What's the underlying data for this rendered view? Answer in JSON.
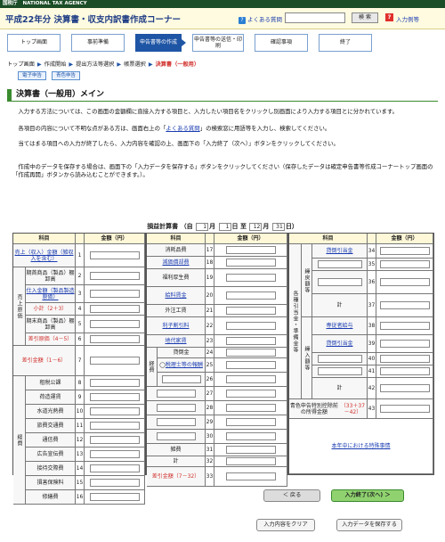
{
  "topbar": {
    "agency_ja": "国税庁",
    "agency_en": "NATIONAL TAX AGENCY"
  },
  "header": {
    "title": "平成22年分 決算書・収支内訳書作成コーナー",
    "faq_label": "よくある質問",
    "search_button": "検 索",
    "help_label": "入力例等",
    "help_icon": "?"
  },
  "steps": [
    "トップ画面",
    "事前準備",
    "申告書等の作成",
    "申告書等の送信・印刷",
    "確認事項",
    "終了"
  ],
  "breadcrumb": [
    "トップ画面",
    "作成開始",
    "提出方法等選択",
    "帳票選択",
    "決算書（一般用）"
  ],
  "tags": [
    "電子申告",
    "青色申告"
  ],
  "section_title": "決算書（一般用）メイン",
  "instructions": [
    "入力する方法については、この画面の金額欄に直接入力する項目と、入力したい項目名をクリックし別画面により入力する項目とに分かれています。",
    "各項目の内容について不明な点がある方は、画面右上の「",
    "よくある質問",
    "」の検索窓に用語等を入力し、検索してください。",
    "当てはまる項目への入力が終了したら、入力内容を確認の上、画面下の「入力終了（次へ）」ボタンをクリックしてください。",
    "作成中のデータを保存する場合は、画面下の「入力データを保存する」ボタンをクリックしてください（保存したデータは確定申告書等作成コーナートップ画面の「作成再開」ボタンから読み込むことができます。）。"
  ],
  "table_title": {
    "name": "損益計算書",
    "from_label": "自",
    "from_month": "1",
    "from_day": "1",
    "to_label": "至",
    "to_month": "12",
    "to_day": "31",
    "month": "月",
    "day": "日"
  },
  "col_headers": {
    "item": "科目",
    "amount": "金額（円）"
  },
  "left_rows": [
    {
      "label": "売上（収入）金額（雑収入を含む）",
      "num": "1",
      "link": true
    },
    {
      "label": "期首商品（製品）棚卸高",
      "num": "2"
    },
    {
      "label": "仕入金額（製品製造原価）",
      "num": "3",
      "link": true
    },
    {
      "label": "小計（2＋3）",
      "num": "4",
      "red": true
    },
    {
      "label": "期末商品（製品）棚卸高",
      "num": "5"
    },
    {
      "label": "差引原価（4－5）",
      "num": "6",
      "red": true
    },
    {
      "label": "差引金額（1－6）",
      "num": "7",
      "red": true
    },
    {
      "label": "租税公課",
      "num": "8"
    },
    {
      "label": "荷造運賃",
      "num": "9"
    },
    {
      "label": "水道光熱費",
      "num": "10"
    },
    {
      "label": "旅費交通費",
      "num": "11"
    },
    {
      "label": "通信費",
      "num": "12"
    },
    {
      "label": "広告宣伝費",
      "num": "13"
    },
    {
      "label": "接待交際費",
      "num": "14"
    },
    {
      "label": "損害保険料",
      "num": "15"
    },
    {
      "label": "修繕費",
      "num": "16"
    }
  ],
  "left_groups": {
    "cost": "売上原価",
    "expense": "経費"
  },
  "mid_rows": [
    {
      "label": "消耗品費",
      "num": "17"
    },
    {
      "label": "減価償却費",
      "num": "18",
      "link": true
    },
    {
      "label": "福利厚生費",
      "num": "19"
    },
    {
      "label": "給料賃金",
      "num": "20",
      "link": true
    },
    {
      "label": "外注工賃",
      "num": "21"
    },
    {
      "label": "利子割引料",
      "num": "22",
      "link": true
    },
    {
      "label": "地代家賃",
      "num": "23",
      "link": true
    },
    {
      "label": "貸倒金",
      "num": "24"
    },
    {
      "label": "税理士等の報酬",
      "num": "25",
      "link": true
    },
    {
      "label": "",
      "num": "26"
    },
    {
      "label": "",
      "num": "27"
    },
    {
      "label": "",
      "num": "28"
    },
    {
      "label": "",
      "num": "29"
    },
    {
      "label": "",
      "num": "30"
    },
    {
      "label": "雑費",
      "num": "31"
    },
    {
      "label": "計",
      "num": "32"
    },
    {
      "label": "差引金額（7－32）",
      "num": "33",
      "red": true
    }
  ],
  "mid_group": "経費",
  "right_rows": [
    {
      "label": "貸倒引当金",
      "num": "34",
      "link": true
    },
    {
      "label": "",
      "num": "35"
    },
    {
      "label": "",
      "num": "36"
    },
    {
      "label": "計",
      "num": "37"
    },
    {
      "label": "専従者給与",
      "num": "38",
      "link": true
    },
    {
      "label": "貸倒引当金",
      "num": "39",
      "link": true
    },
    {
      "label": "",
      "num": "40"
    },
    {
      "label": "",
      "num": "41"
    },
    {
      "label": "計",
      "num": "42"
    },
    {
      "label": "青色申告特別控除前の所得金額（33＋37－42）",
      "num": "43",
      "red_part": "（33＋37－42）"
    }
  ],
  "right_groups": {
    "reserve_in": "繰戻額等",
    "reserve_out": "繰入額等",
    "side": "各種引当金・準備金等"
  },
  "special_link": "本年中における特殊事情",
  "buttons": {
    "back": "＜ 戻る",
    "next": "入力終了(次へ) ＞",
    "clear": "入力内容をクリア",
    "save": "入力データを保存する"
  }
}
